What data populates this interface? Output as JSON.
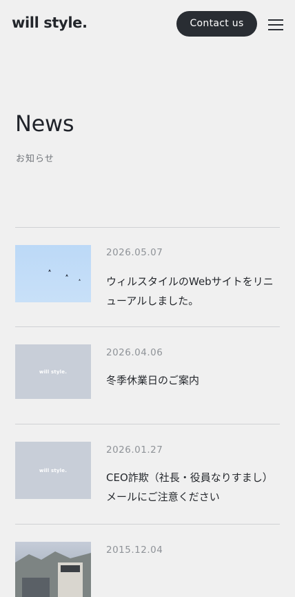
{
  "header": {
    "logo": "will style.",
    "contact_label": "Contact us"
  },
  "page": {
    "title": "News",
    "subtitle": "お知らせ"
  },
  "news": [
    {
      "date": "2026.05.07",
      "title": "ウィルスタイルのWebサイトをリニューアルしました。",
      "thumb": "sky-with-birds"
    },
    {
      "date": "2026.04.06",
      "title": "冬季休業日のご案内",
      "thumb": "will style placeholder",
      "thumb_logo": "will style."
    },
    {
      "date": "2026.01.27",
      "title": "CEO詐欺（社長・役員なりすまし）メールにご注意ください",
      "thumb": "will style placeholder",
      "thumb_logo": "will style."
    },
    {
      "date": "2015.12.04",
      "title": "",
      "thumb": "photo"
    }
  ],
  "colors": {
    "background": "#f0f0f0",
    "button": "#292d33",
    "divider": "#cfd1d4",
    "date": "#8e9297"
  }
}
